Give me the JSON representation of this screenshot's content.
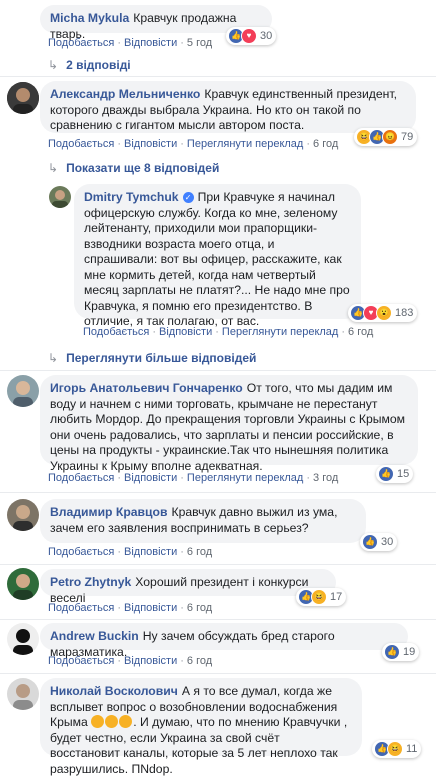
{
  "actions": {
    "like": "Подобається",
    "reply": "Відповісти",
    "translate": "Переглянути переклад"
  },
  "comments": [
    {
      "name": "Micha Mykula",
      "text": "Кравчук продажна тварь.",
      "time": "5 год",
      "reactions": "30"
    },
    {
      "name": "Александр Мельниченко",
      "text": "Кравчук единственный президент, которого дважды выбрала Украина. Но кто он такой по сравнению с гигантом мысли автором поста.",
      "time": "6 год",
      "reactions": "79"
    },
    {
      "name": "Dmitry Tymchuk",
      "text": "При Кравчуке я начинал офицерскую службу. Когда ко мне, зеленому лейтенанту, приходили мои прапорщики-взводники возраста моего отца, и спрашивали: вот вы офицер, расскажите, как мне кормить детей, когда нам четвертый месяц зарплаты не платят?... Не надо мне про Кравчука, я помню его президентство. В отличие, я так полагаю, от вас.",
      "time": "6 год",
      "reactions": "183"
    },
    {
      "name": "Игорь Анатольевич Гончаренко",
      "text": "От того, что мы дадим им воду и начнем с ними торговать, крымчане не перестанут любить Мордор. До прекращения торговли Украины с Крымом они очень радовались, что зарплаты и пенсии российские, в цены на продукты - украинские.Так что нынешняя политика Украины к Крыму вполне адекватная.",
      "time": "3 год",
      "reactions": "15"
    },
    {
      "name": "Владимир Кравцов",
      "text": "Кравчук давно выжил из ума, зачем его заявления воспринимать в серьез?",
      "time": "6 год",
      "reactions": "30"
    },
    {
      "name": "Petro Zhytnyk",
      "text": "Хороший президент і конкурси веселі",
      "time": "6 год",
      "reactions": "17"
    },
    {
      "name": "Andrew Buckin",
      "text": "Ну зачем обсуждать бред старого маразматика.",
      "time": "6 год",
      "reactions": "19"
    },
    {
      "name": "Николай Восколович",
      "text1": "А я то все думал, когда же всплывет вопрос о возобновлении водоснабжения Крыма",
      "text2": ". И думаю, что по мнению Кравчучки , будет честно, если Украина за свой счёт восстановит каналы, которые за 5 лет неплохо так разрушились. ПNdop.",
      "reactions": "11"
    }
  ],
  "replies": {
    "two": "2 відповіді",
    "show8": "Показати ще 8 відповідей",
    "more": "Переглянути більше відповідей"
  },
  "colors": {
    "link": "#385898",
    "bubble": "#f2f3f5",
    "meta": "#606770"
  }
}
